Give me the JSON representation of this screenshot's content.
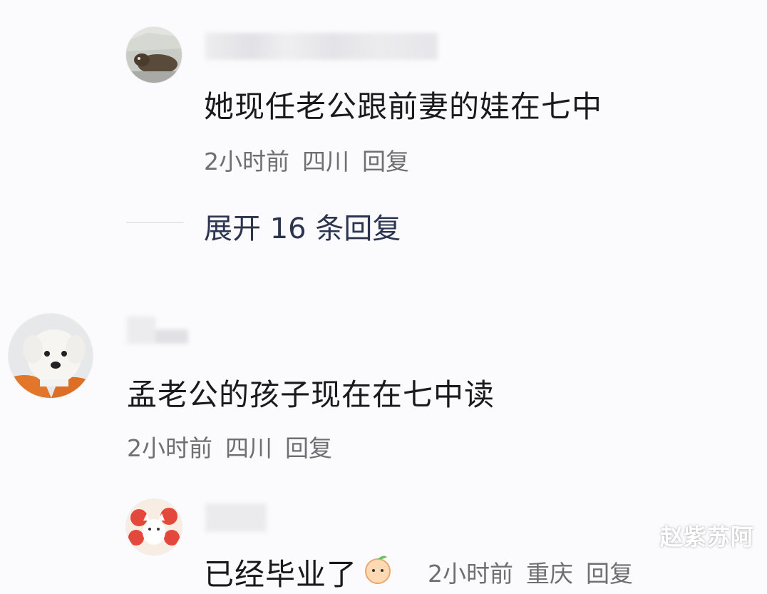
{
  "comments": [
    {
      "avatar_icon": "cat-photo-avatar",
      "text": "她现任老公跟前妻的娃在七中",
      "time": "2小时前",
      "location": "四川",
      "reply_label": "回复",
      "expand_label": "展开 16 条回复"
    },
    {
      "avatar_icon": "white-dog-avatar",
      "text": "孟老公的孩子现在在七中读",
      "time": "2小时前",
      "location": "四川",
      "reply_label": "回复"
    },
    {
      "avatar_icon": "cartoon-avatar",
      "text": "已经毕业了",
      "emoji_icon": "peach-emoji-icon",
      "time": "2小时前",
      "location": "重庆",
      "reply_label": "回复"
    }
  ],
  "watermark": "赵紫苏阿",
  "colors": {
    "background": "#fbfbfd",
    "text": "#1a1a1a",
    "meta": "#6e6e73",
    "expand": "#2c3550"
  }
}
